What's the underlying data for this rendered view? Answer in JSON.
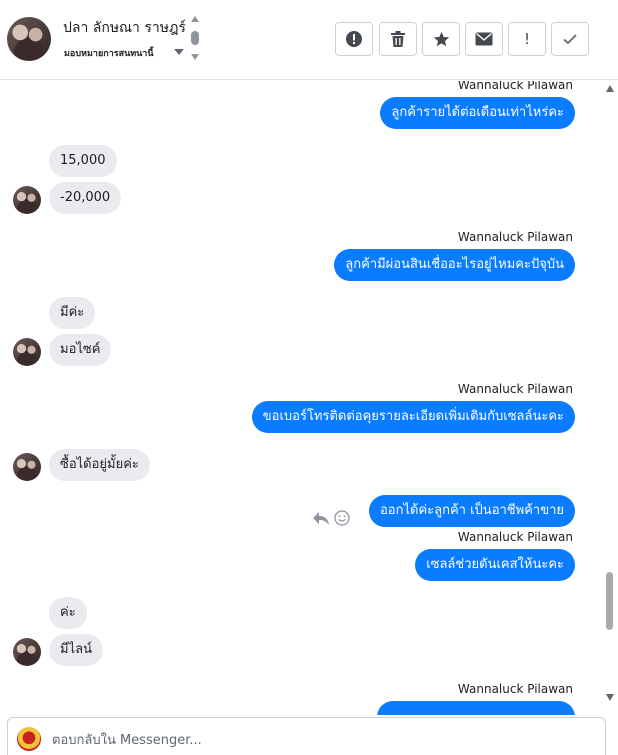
{
  "header": {
    "contact_name": "ปลา ลักษณา ราษฎร์",
    "assignment_label": "มอบหมายการสนทนานี้"
  },
  "toolbar": {
    "buttons": [
      {
        "icon": "alert-circle-icon",
        "label": "!"
      },
      {
        "icon": "trash-icon"
      },
      {
        "icon": "star-icon"
      },
      {
        "icon": "envelope-icon"
      },
      {
        "icon": "exclamation-icon",
        "label": "!"
      },
      {
        "icon": "check-icon"
      }
    ]
  },
  "conversation": {
    "sender_name": "Wannaluck Pilawan",
    "messages": [
      {
        "dir": "out",
        "text": "ลูกค้ารายได้ต่อเดือนเท่าไหร่คะ"
      },
      {
        "dir": "in",
        "text": "15,000"
      },
      {
        "dir": "in",
        "text": "-20,000"
      },
      {
        "dir": "out",
        "text": "ลูกค้ามีผ่อนสินเชื่ออะไรอยู่ไหมคะปัจุบัน"
      },
      {
        "dir": "in",
        "text": "มีค่ะ"
      },
      {
        "dir": "in",
        "text": "มอไซค์"
      },
      {
        "dir": "out",
        "text": "ขอเบอร์โทรติดต่อคุยรายละเอียดเพิ่มเติมกับเซลล์นะคะ"
      },
      {
        "dir": "in",
        "text": "ซื้อได้อยู่มั้ยค่ะ"
      },
      {
        "dir": "out",
        "text": "ออกได้ค่ะลูกค้า  เป็นอาชีพค้าขาย"
      },
      {
        "dir": "out",
        "text": "เซลล์ช่วยดันเคสให้นะคะ"
      },
      {
        "dir": "in",
        "text": "ค่ะ"
      },
      {
        "dir": "in",
        "text": "มีไลน์"
      }
    ]
  },
  "reply": {
    "placeholder": "ตอบกลับใน Messenger..."
  },
  "colors": {
    "outgoing_bubble": "#0a7cff",
    "incoming_bubble": "#e9ebee"
  }
}
